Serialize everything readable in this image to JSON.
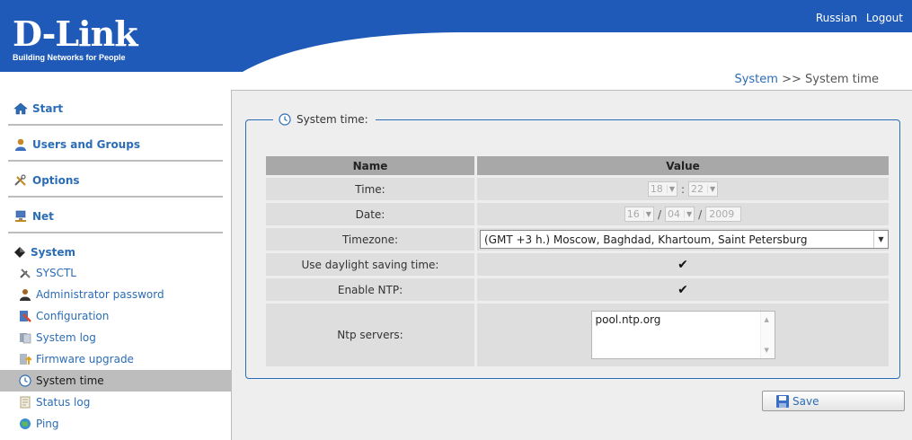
{
  "header": {
    "brand": "D-Link",
    "tagline": "Building Networks for People",
    "links": [
      "Russian",
      "Logout"
    ]
  },
  "breadcrumb": {
    "parent": "System",
    "separator": ">>",
    "current": "System time"
  },
  "sidebar": {
    "sections": [
      {
        "label": "Start",
        "icon": "home-icon"
      },
      {
        "label": "Users and Groups",
        "icon": "users-icon"
      },
      {
        "label": "Options",
        "icon": "tools-icon"
      },
      {
        "label": "Net",
        "icon": "network-icon"
      }
    ],
    "system": {
      "label": "System",
      "items": [
        {
          "label": "SYSCTL",
          "icon": "wrench-icon"
        },
        {
          "label": "Administrator password",
          "icon": "admin-icon"
        },
        {
          "label": "Configuration",
          "icon": "configuration-icon"
        },
        {
          "label": "System log",
          "icon": "system-log-icon"
        },
        {
          "label": "Firmware upgrade",
          "icon": "firmware-icon"
        },
        {
          "label": "System time",
          "icon": "clock-icon",
          "active": true
        },
        {
          "label": "Status log",
          "icon": "status-log-icon"
        },
        {
          "label": "Ping",
          "icon": "ping-icon"
        }
      ]
    }
  },
  "panel": {
    "legend": "System time:",
    "table": {
      "headers": {
        "name": "Name",
        "value": "Value"
      },
      "time": {
        "label": "Time:",
        "hour": "18",
        "minute": "22",
        "sep": ":"
      },
      "date": {
        "label": "Date:",
        "day": "16",
        "month": "04",
        "year": "2009",
        "sep": "/"
      },
      "timezone": {
        "label": "Timezone:",
        "value": "(GMT +3 h.) Moscow, Baghdad, Khartoum, Saint Petersburg"
      },
      "dst": {
        "label": "Use daylight saving time:",
        "checked": true,
        "mark": "✔"
      },
      "ntp": {
        "label": "Enable NTP:",
        "checked": true,
        "mark": "✔"
      },
      "ntp_servers": {
        "label": "Ntp servers:",
        "value": "pool.ntp.org"
      }
    }
  },
  "save_label": "Save",
  "colors": {
    "header_blue": "#1f5ab8",
    "link_blue": "#2b6db5",
    "active_item": "#bdbdbd",
    "content_bg": "#eeeeee"
  }
}
